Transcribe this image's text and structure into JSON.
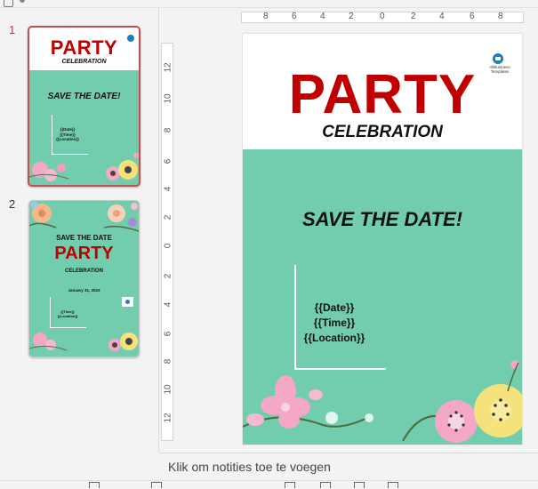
{
  "thumbnails": {
    "slides": [
      {
        "number": "1",
        "party": "PARTY",
        "celebration": "CELEBRATION",
        "save_the_date": "SAVE THE DATE!",
        "placeholders": [
          "{{Date}}",
          "{{Time}}",
          "{{Location}}"
        ]
      },
      {
        "number": "2",
        "save_the_date": "SAVE THE DATE",
        "party": "PARTY",
        "celebration": "CELEBRATION",
        "date": "January 31, 2023",
        "placeholders": [
          "{{Time}}",
          "{{Location}}"
        ]
      }
    ]
  },
  "ruler": {
    "horizontal": [
      "8",
      "6",
      "4",
      "2",
      "0",
      "2",
      "4",
      "6",
      "8"
    ],
    "vertical": [
      "12",
      "10",
      "8",
      "6",
      "4",
      "2",
      "0",
      "2",
      "4",
      "6",
      "8",
      "10",
      "12"
    ]
  },
  "slide": {
    "party": "PARTY",
    "celebration": "CELEBRATION",
    "save_the_date": "SAVE THE DATE!",
    "placeholders": [
      "{{Date}}",
      "{{Time}}",
      "{{Location}}"
    ],
    "logo_text": "AllBusiness Templates"
  },
  "notes": {
    "placeholder": "Klik om notities toe te voegen"
  },
  "colors": {
    "accent_red": "#c00000",
    "slide_green": "#72cdae",
    "selection_border": "#c0504d"
  }
}
